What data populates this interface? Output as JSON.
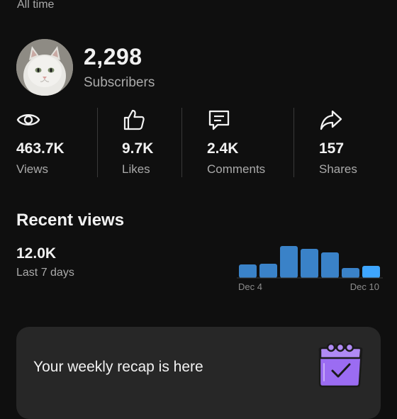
{
  "header": {
    "period": "All time"
  },
  "channel": {
    "subscriber_count": "2,298",
    "subscriber_label": "Subscribers"
  },
  "stats": [
    {
      "icon": "eye-icon",
      "value": "463.7K",
      "label": "Views"
    },
    {
      "icon": "thumbs-up-icon",
      "value": "9.7K",
      "label": "Likes"
    },
    {
      "icon": "comment-icon",
      "value": "2.4K",
      "label": "Comments"
    },
    {
      "icon": "share-icon",
      "value": "157",
      "label": "Shares"
    }
  ],
  "recent": {
    "title": "Recent views",
    "value": "12.0K",
    "subtitle": "Last 7 days"
  },
  "chart_data": {
    "type": "bar",
    "x_start_label": "Dec 4",
    "x_end_label": "Dec 10",
    "values": [
      0.4,
      0.41,
      0.94,
      0.86,
      0.76,
      0.29,
      0.35
    ],
    "highlight_index": 6,
    "bar_color": "#3a82c8",
    "highlight_color": "#3ea6ff"
  },
  "recap": {
    "title": "Your weekly recap is here",
    "icon": "calendar-check-icon"
  },
  "colors": {
    "background": "#0f0f0f",
    "card": "#272727",
    "accent": "#3ea6ff",
    "icon_purple": "#9b6cf2"
  }
}
